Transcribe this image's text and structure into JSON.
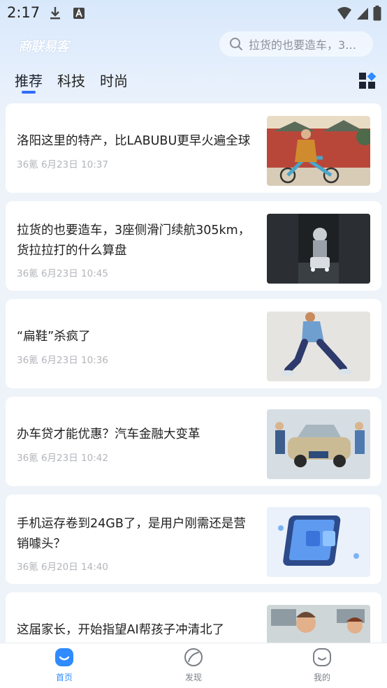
{
  "status_bar": {
    "time": "2:17"
  },
  "header": {
    "logo": "商联易客",
    "search_text": "拉货的也要造车，3…"
  },
  "tabs": [
    {
      "label": "推荐",
      "active": true
    },
    {
      "label": "科技",
      "active": false
    },
    {
      "label": "时尚",
      "active": false
    }
  ],
  "articles": [
    {
      "title": "洛阳这里的特产，比LABUBU更早火遍全球",
      "meta": "36氪 6月23日 10:37",
      "image": "temple-cyclist"
    },
    {
      "title": "拉货的也要造车，3座侧滑门续航305km，货拉拉打的什么算盘",
      "meta": "36氪 6月23日 10:45",
      "image": "robot-car"
    },
    {
      "title": "“扁鞋”杀疯了",
      "meta": "36氪 6月23日 10:36",
      "image": "walking-person"
    },
    {
      "title": "办车贷才能优惠？汽车金融大变革",
      "meta": "36氪 6月23日 10:42",
      "image": "car-crowd"
    },
    {
      "title": "手机运存卷到24GB了，是用户刚需还是营销噱头？",
      "meta": "36氪 6月20日 14:40",
      "image": "smartphone-4g"
    },
    {
      "title": "这届家长，开始指望AI帮孩子冲清北了",
      "meta": "",
      "image": "parent-kids"
    }
  ],
  "bottom_nav": [
    {
      "label": "首页",
      "icon": "home-icon",
      "active": true
    },
    {
      "label": "发现",
      "icon": "discover-icon",
      "active": false
    },
    {
      "label": "我的",
      "icon": "profile-icon",
      "active": false
    }
  ],
  "colors": {
    "accent": "#2f6df6",
    "nav_active": "#2f8bff",
    "meta": "#b2b5ba"
  }
}
